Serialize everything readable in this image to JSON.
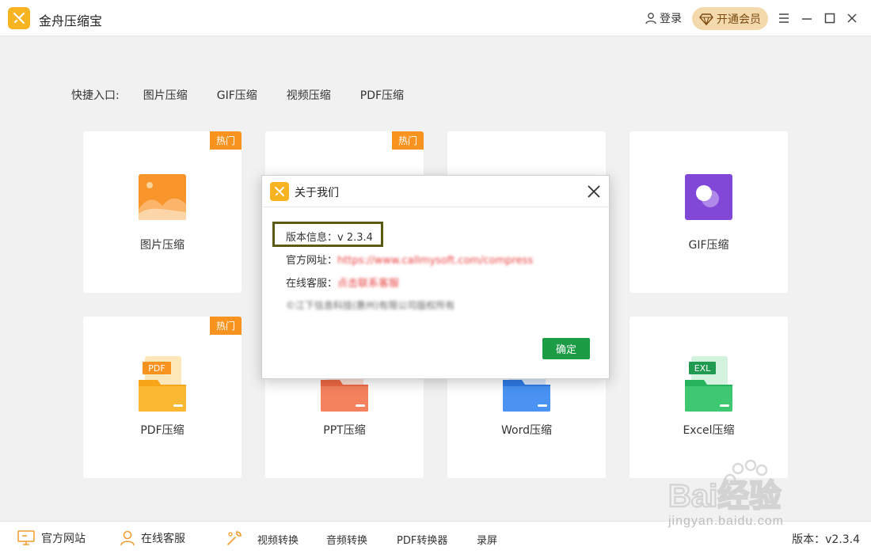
{
  "app": {
    "title": "金舟压缩宝"
  },
  "header": {
    "login": "登录",
    "vip": "开通会员"
  },
  "quick": {
    "label": "快捷入口:",
    "items": [
      "图片压缩",
      "GIF压缩",
      "视频压缩",
      "PDF压缩"
    ]
  },
  "cards": [
    {
      "label": "图片压缩",
      "badge": "热门"
    },
    {
      "badge": "热门"
    },
    {
      "label": "GIF压缩"
    },
    {
      "label": "PDF压缩",
      "badge": "热门",
      "tag": "PDF"
    },
    {
      "label": "PPT压缩"
    },
    {
      "label": "Word压缩"
    },
    {
      "label": "Excel压缩",
      "tag": "EXL"
    }
  ],
  "dialog": {
    "title": "关于我们",
    "version_label": "版本信息：",
    "version_value": "v 2.3.4",
    "site_label": "官方网址：",
    "site_value": "https://www.callmysoft.com/compress",
    "service_label": "在线客服：",
    "service_value": "点击联系客服",
    "copyright": "©江下信息科技(惠州)有限公司版权所有",
    "ok": "确定"
  },
  "bottom": {
    "site": "官方网站",
    "service": "在线客服",
    "video": "视频转换",
    "audio": "音频转换",
    "pdf": "PDF转换器",
    "record": "录屏",
    "version": "版本：v2.3.4"
  },
  "watermark": {
    "text": "jingyan.baidu.com",
    "logo_text": "Bai经验"
  },
  "colors": {
    "accent": "#f7b320",
    "badge": "#f7931e",
    "ok": "#1c9c45",
    "vip": "#f3d9ac"
  }
}
